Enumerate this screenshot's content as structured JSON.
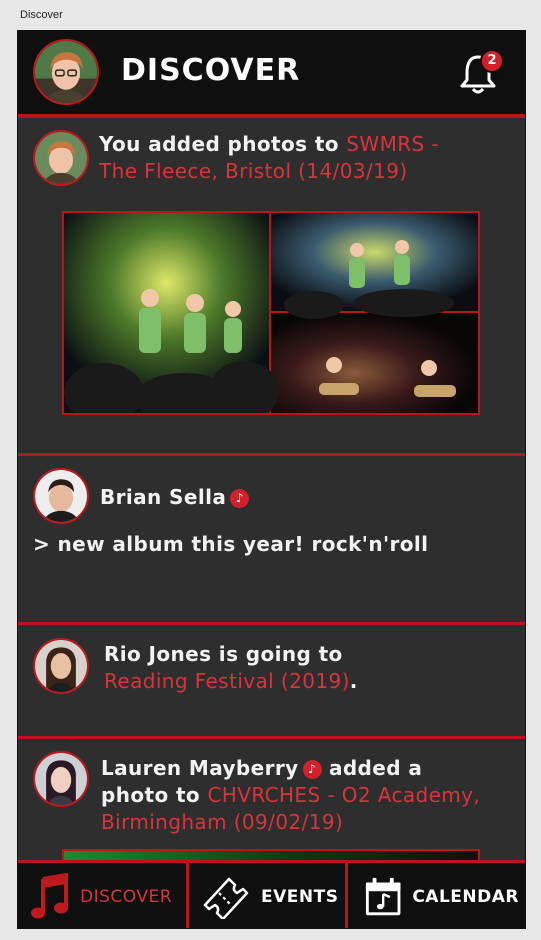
{
  "window": {
    "title": "Discover"
  },
  "header": {
    "title": "DISCOVER",
    "notification_count": "2"
  },
  "feed": [
    {
      "prefix": "You added photos to ",
      "link": "SWMRS - The Fleece, Bristol (14/03/19)"
    },
    {
      "name": "Brian Sella",
      "message": "> new album this year! rock'n'roll"
    },
    {
      "prefix": "Rio Jones is going to",
      "link": "Reading Festival (2019)",
      "suffix": "."
    },
    {
      "name": "Lauren Mayberry",
      "action": " added a photo to ",
      "link": "CHVRCHES - O2 Academy, Birmingham (09/02/19)"
    }
  ],
  "nav": [
    {
      "label": "DISCOVER",
      "icon": "music-note-icon",
      "active": true
    },
    {
      "label": "EVENTS",
      "icon": "ticket-icon",
      "active": false
    },
    {
      "label": "CALENDAR",
      "icon": "calendar-icon",
      "active": false
    }
  ],
  "colors": {
    "accent": "#b8161c",
    "link": "#d9343c",
    "background": "#2e2e2e",
    "bar": "#0f0f0f"
  }
}
